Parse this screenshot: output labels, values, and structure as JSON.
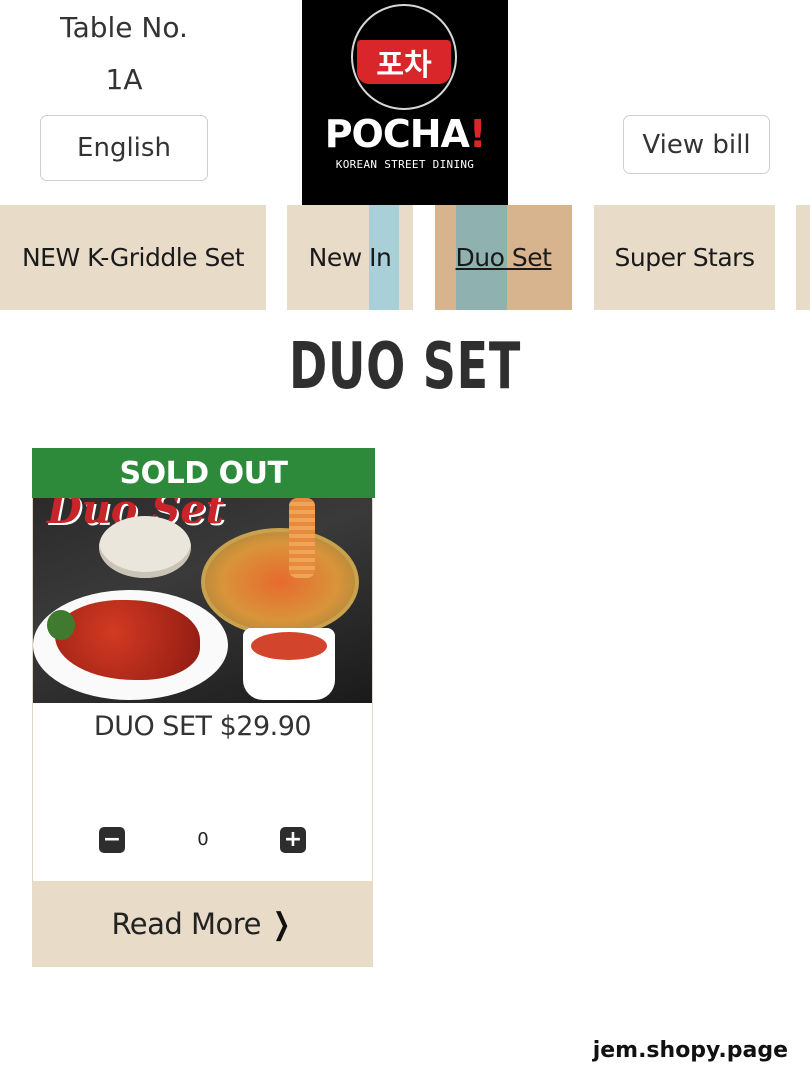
{
  "header": {
    "table_label": "Table No.",
    "table_number": "1A",
    "language_button": "English",
    "view_bill_button": "View bill"
  },
  "logo": {
    "korean_text": "포차",
    "wordmark": "POCHA",
    "wordmark_accent": "!",
    "subtitle": "KOREAN STREET DINING"
  },
  "categories": [
    {
      "label": "NEW K-Griddle Set"
    },
    {
      "label": "New In"
    },
    {
      "label": "Duo Set",
      "active": true
    },
    {
      "label": "Super Stars"
    }
  ],
  "section": {
    "title": "DUO SET"
  },
  "product": {
    "badge": "SOLD OUT",
    "photo_caption": "Duo Set",
    "name_price": "DUO SET $29.90",
    "quantity": "0",
    "minus_icon": "minus-icon",
    "plus_icon": "plus-icon",
    "read_more": "Read More",
    "read_more_icon": "chevron-right-icon"
  },
  "footer": {
    "watermark": "jem.shopy.page"
  },
  "colors": {
    "tab_bg": "#e8dcc9",
    "tab_active_bg": "#d8b48e",
    "sold_out_bg": "#2c8a3a",
    "logo_bg": "#000000",
    "logo_red": "#d8262b"
  }
}
